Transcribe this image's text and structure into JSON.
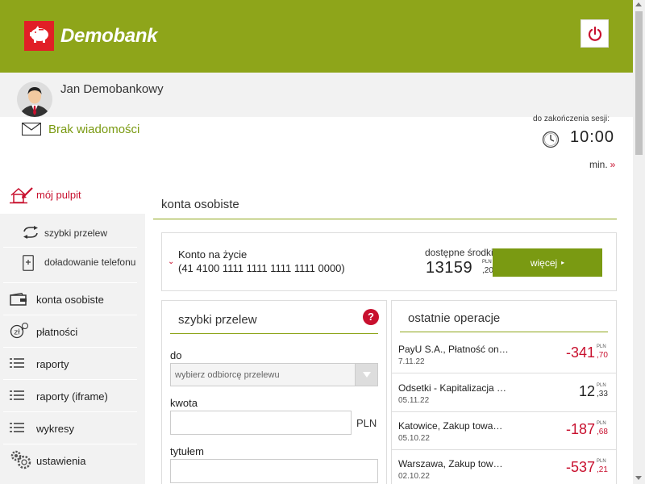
{
  "header": {
    "logo_text": "Demobank",
    "logo_icon": "piggy-bank-icon",
    "logout_icon": "power-icon",
    "brand_color": "#8ea51a",
    "accent_color": "#c8102e"
  },
  "user": {
    "name": "Jan Demobankowy",
    "avatar_icon": "user-avatar-icon"
  },
  "messages": {
    "label": "Brak wiadomości",
    "icon": "envelope-icon"
  },
  "session": {
    "label": "do zakończenia sesji:",
    "time": "10:00",
    "unit": "min.",
    "unit_arrow": "»",
    "icon": "clock-icon"
  },
  "sidebar": {
    "active": {
      "label": "mój pulpit",
      "icon": "house-icon"
    },
    "sub_items": [
      {
        "label": "szybki przelew",
        "icon": "transfer-arrows-icon"
      },
      {
        "label": "doładowanie telefonu",
        "icon": "phone-icon"
      }
    ],
    "items": [
      {
        "label": "konta osobiste",
        "icon": "wallet-icon"
      },
      {
        "label": "płatności",
        "icon": "payments-icon"
      },
      {
        "label": "raporty",
        "icon": "list-icon"
      },
      {
        "label": "raporty (iframe)",
        "icon": "list-icon"
      },
      {
        "label": "wykresy",
        "icon": "list-icon"
      },
      {
        "label": "ustawienia",
        "icon": "gears-icon"
      }
    ]
  },
  "main": {
    "title": "konta osobiste",
    "account": {
      "name": "Konto na życie",
      "number": "(41 4100 1111 1111 1111 1111 0000)",
      "available_label": "dostępne środki",
      "amount_main": "13159",
      "amount_currency": "PLN",
      "amount_cents": ",20",
      "more_label": "więcej",
      "more_arrow": "▸"
    },
    "quick_transfer": {
      "title": "szybki przelew",
      "help_label": "?",
      "to_label": "do",
      "select_placeholder": "wybierz odbiorcę przelewu",
      "amount_label": "kwota",
      "currency": "PLN",
      "title_label": "tytułem"
    },
    "operations": {
      "title": "ostatnie operacje",
      "rows": [
        {
          "desc": "PayU S.A., Płatność on…",
          "date": "7.11.22",
          "amount": "-341",
          "currency": "PLN",
          "cents": ",70",
          "sign": "neg"
        },
        {
          "desc": "Odsetki - Kapitalizacja …",
          "date": "05.11.22",
          "amount": "12",
          "currency": "PLN",
          "cents": ",33",
          "sign": "pos"
        },
        {
          "desc": "Katowice, Zakup towa…",
          "date": "05.10.22",
          "amount": "-187",
          "currency": "PLN",
          "cents": ",68",
          "sign": "neg"
        },
        {
          "desc": "Warszawa, Zakup tow…",
          "date": "02.10.22",
          "amount": "-537",
          "currency": "PLN",
          "cents": ",21",
          "sign": "neg"
        }
      ]
    }
  }
}
